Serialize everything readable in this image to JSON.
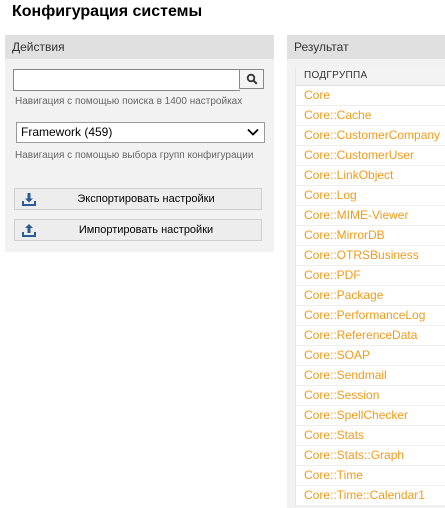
{
  "page": {
    "title": "Конфигурация системы"
  },
  "actions_panel": {
    "header": "Действия",
    "search": {
      "value": "",
      "placeholder": "",
      "hint": "Навигация с помощью поиска в 1400 настройках"
    },
    "group_select": {
      "selected": "Framework (459)",
      "hint": "Навигация с помощью выбора групп конфигурации"
    },
    "buttons": {
      "export": "Экспортировать настройки",
      "import": "Импортировать настройки"
    }
  },
  "results_panel": {
    "header": "Результат",
    "column_header": "ПОДГРУППА",
    "rows": [
      "Core",
      "Core::Cache",
      "Core::CustomerCompany",
      "Core::CustomerUser",
      "Core::LinkObject",
      "Core::Log",
      "Core::MIME-Viewer",
      "Core::MirrorDB",
      "Core::OTRSBusiness",
      "Core::PDF",
      "Core::Package",
      "Core::PerformanceLog",
      "Core::ReferenceData",
      "Core::SOAP",
      "Core::Sendmail",
      "Core::Session",
      "Core::SpellChecker",
      "Core::Stats",
      "Core::Stats::Graph",
      "Core::Time",
      "Core::Time::Calendar1"
    ]
  },
  "colors": {
    "link": "#f49a1a",
    "panel_bg": "#f2f2f2",
    "header_bg": "#e0e0e0"
  }
}
